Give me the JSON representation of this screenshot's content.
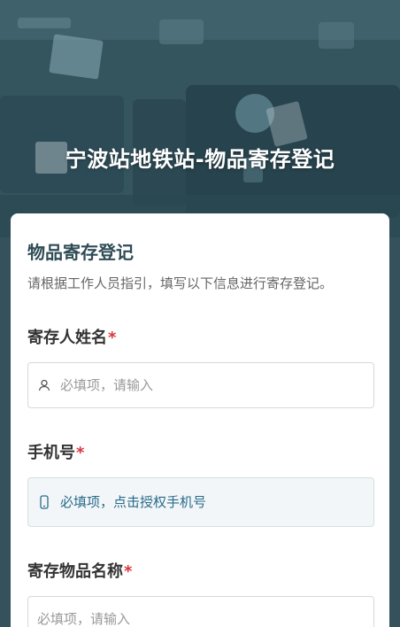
{
  "header": {
    "title": "宁波站地铁站-物品寄存登记"
  },
  "form": {
    "title": "物品寄存登记",
    "description": "请根据工作人员指引，填写以下信息进行寄存登记。",
    "fields": [
      {
        "label": "寄存人姓名",
        "required_mark": "*",
        "placeholder": "必填项，请输入",
        "icon": "person-icon"
      },
      {
        "label": "手机号",
        "required_mark": "*",
        "placeholder": "必填项，点击授权手机号",
        "icon": "phone-icon"
      },
      {
        "label": "寄存物品名称",
        "required_mark": "*",
        "placeholder": "必填项，请输入"
      }
    ]
  },
  "colors": {
    "accent": "#2f4c56",
    "required": "#d9363e",
    "phone_link": "#2a6b8a"
  }
}
